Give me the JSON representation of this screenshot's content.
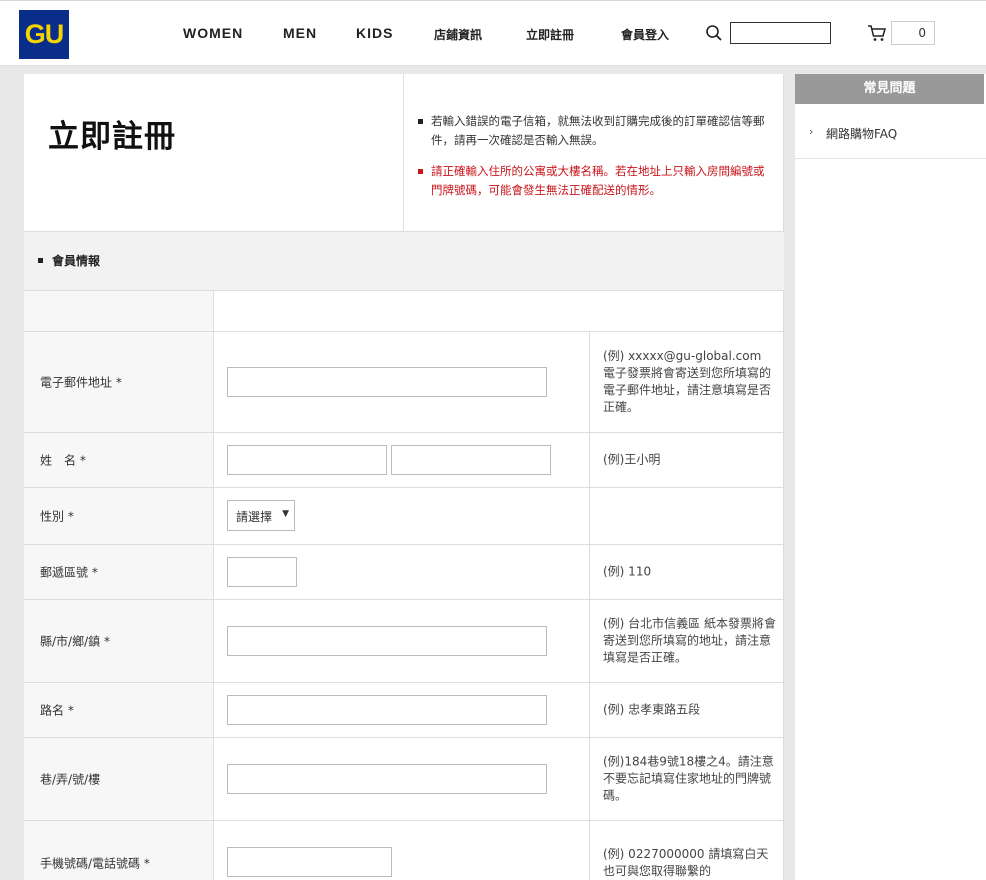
{
  "header": {
    "logo": "GU",
    "nav": [
      "WOMEN",
      "MEN",
      "KIDS",
      "店鋪資訊",
      "立即註冊",
      "會員登入"
    ],
    "search_value": "",
    "cart_count": "0"
  },
  "page": {
    "title": "立即註冊",
    "notices": [
      "若輸入錯誤的電子信箱，就無法收到訂購完成後的訂單確認信等郵件，請再一次確認是否輸入無誤。",
      "請正確輸入住所的公寓或大樓名稱。若在地址上只輸入房間編號或門牌號碼，可能會發生無法正確配送的情形。"
    ],
    "section_title": "會員情報"
  },
  "form": {
    "rows": [
      {
        "label": "",
        "example": ""
      },
      {
        "label": "電子郵件地址 *",
        "example": "(例) xxxxx@gu-global.com 電子發票將會寄送到您所填寫的電子郵件地址，請注意填寫是否正確。"
      },
      {
        "label": "姓　名 *",
        "example": "(例)王小明"
      },
      {
        "label": "性別 *",
        "example": ""
      },
      {
        "label": "郵遞區號 *",
        "example": "(例) 110"
      },
      {
        "label": "縣/市/鄉/鎮 *",
        "example": "(例) 台北市信義區 紙本發票將會寄送到您所填寫的地址，請注意填寫是否正確。"
      },
      {
        "label": "路名 *",
        "example": "(例) 忠孝東路五段"
      },
      {
        "label": "巷/弄/號/樓",
        "example": "(例)184巷9號18樓之4。請注意不要忘記填寫住家地址的門牌號碼。"
      },
      {
        "label": "手機號碼/電話號碼 *",
        "example": "(例) 0227000000 請填寫白天也可與您取得聯繫的"
      }
    ],
    "gender_select": "請選擇"
  },
  "sidebar": {
    "title": "常見問題",
    "items": [
      "網路購物FAQ"
    ]
  }
}
